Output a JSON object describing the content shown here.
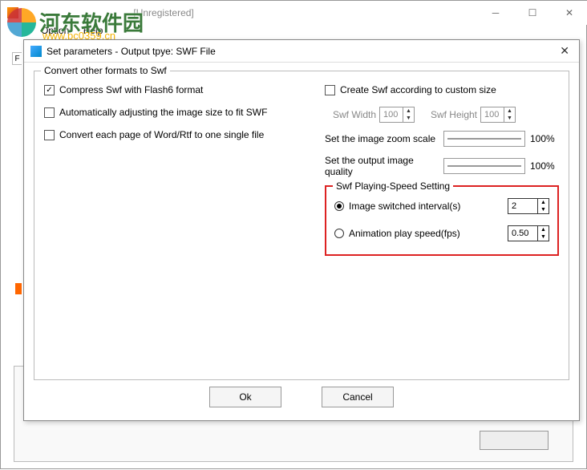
{
  "main_window": {
    "title_fragment": "[Unregistered]",
    "menu": {
      "option": "Option",
      "help": "Help"
    }
  },
  "watermark": {
    "text": "河东软件园",
    "url": "www.pc0359.cn"
  },
  "dialog": {
    "title": "Set parameters - Output tpye: SWF File",
    "group_legend": "Convert other formats to Swf",
    "left": {
      "compress": "Compress Swf with Flash6 format",
      "auto_adjust": "Automatically adjusting the image size to fit SWF",
      "each_page": "Convert each page of Word/Rtf to one single file"
    },
    "right": {
      "create_custom": "Create Swf according to custom size",
      "swf_width_lbl": "Swf Width",
      "swf_width_val": "100",
      "swf_height_lbl": "Swf Height",
      "swf_height_val": "100",
      "zoom_lbl": "Set the image zoom scale",
      "zoom_pct": "100%",
      "quality_lbl": "Set the output image quality",
      "quality_pct": "100%"
    },
    "speed": {
      "legend": "Swf Playing-Speed Setting",
      "interval_lbl": "Image switched interval(s)",
      "interval_val": "2",
      "fps_lbl": "Animation play speed(fps)",
      "fps_val": "0.50"
    },
    "buttons": {
      "ok": "Ok",
      "cancel": "Cancel"
    }
  },
  "left_tab": "F"
}
